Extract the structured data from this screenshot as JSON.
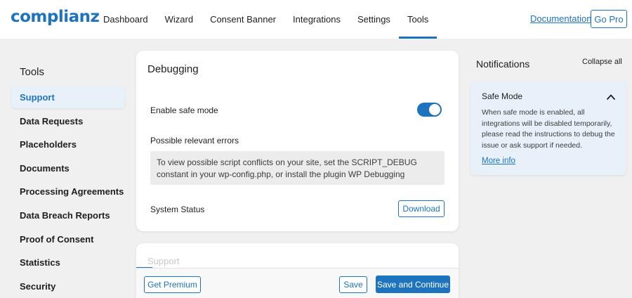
{
  "header": {
    "logo": "complianz",
    "nav": [
      "Dashboard",
      "Wizard",
      "Consent Banner",
      "Integrations",
      "Settings",
      "Tools"
    ],
    "active_nav": "Tools",
    "documentation_label": "Documentation",
    "gopro_label": "Go Pro"
  },
  "sidebar": {
    "title": "Tools",
    "items": [
      {
        "label": "Support",
        "active": true
      },
      {
        "label": "Data Requests"
      },
      {
        "label": "Placeholders"
      },
      {
        "label": "Documents"
      },
      {
        "label": "Processing Agreements"
      },
      {
        "label": "Data Breach Reports"
      },
      {
        "label": "Proof of Consent"
      },
      {
        "label": "Statistics"
      },
      {
        "label": "Security"
      }
    ]
  },
  "debugging": {
    "title": "Debugging",
    "safe_mode_label": "Enable safe mode",
    "safe_mode_on": true,
    "errors_label": "Possible relevant errors",
    "errors_text": "To view possible script conflicts on your site, set the SCRIPT_DEBUG constant in your wp-config.php, or install the plugin WP Debugging",
    "system_status_label": "System Status",
    "download_label": "Download"
  },
  "support_card": {
    "title": "Support"
  },
  "footer": {
    "get_premium_label": "Get Premium",
    "save_label": "Save",
    "save_continue_label": "Save and Continue"
  },
  "notifications": {
    "title": "Notifications",
    "collapse_all_label": "Collapse all",
    "items": [
      {
        "title": "Safe Mode",
        "text": "When safe mode is enabled, all integrations will be disabled temporarily, please read the instructions to debug the issue or ask support if needed.",
        "link": "More info"
      }
    ]
  },
  "colors": {
    "accent": "#1e73be",
    "page_bg": "#f0f0f1",
    "card_bg": "#ffffff",
    "notification_bg": "#e8f1fa"
  },
  "icons": {
    "notification_toggle": "chevron-up-icon"
  }
}
